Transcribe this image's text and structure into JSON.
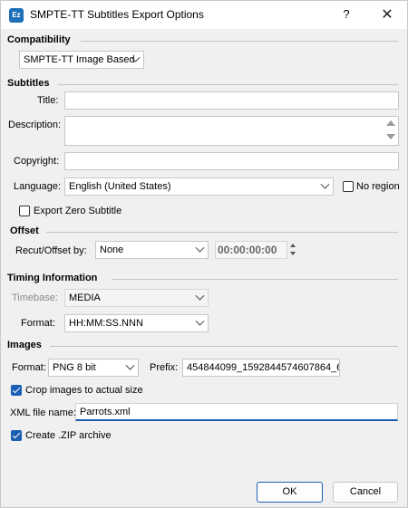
{
  "window": {
    "title": "SMPTE-TT Subtitles Export Options",
    "icon_text": "Ez",
    "help_glyph": "?",
    "close_glyph": "✕"
  },
  "compatibility": {
    "heading": "Compatibility",
    "mode": "SMPTE-TT Image Based"
  },
  "subtitles": {
    "heading": "Subtitles",
    "title_label": "Title:",
    "title_value": "",
    "description_label": "Description:",
    "description_value": "",
    "copyright_label": "Copyright:",
    "copyright_value": "",
    "language_label": "Language:",
    "language_value": "English (United States)",
    "no_region_label": "No region",
    "no_region_checked": false,
    "export_zero_label": "Export Zero Subtitle",
    "export_zero_checked": false
  },
  "offset": {
    "heading": "Offset",
    "recut_label": "Recut/Offset by:",
    "recut_value": "None",
    "timecode": "00:00:00:00"
  },
  "timing": {
    "heading": "Timing Information",
    "timebase_label": "Timebase:",
    "timebase_value": "MEDIA",
    "format_label": "Format:",
    "format_value": "HH:MM:SS.NNN"
  },
  "images": {
    "heading": "Images",
    "format_label": "Format:",
    "format_value": "PNG 8 bit",
    "prefix_label": "Prefix:",
    "prefix_value": "454844099_1592844574607864_6",
    "crop_label": "Crop images to actual size",
    "crop_checked": true,
    "xml_label": "XML file name:",
    "xml_value": "Parrots.xml",
    "zip_label": "Create .ZIP archive",
    "zip_checked": true
  },
  "buttons": {
    "ok": "OK",
    "cancel": "Cancel"
  },
  "colors": {
    "accent": "#1a5fb4",
    "background": "#f0f0f0"
  }
}
